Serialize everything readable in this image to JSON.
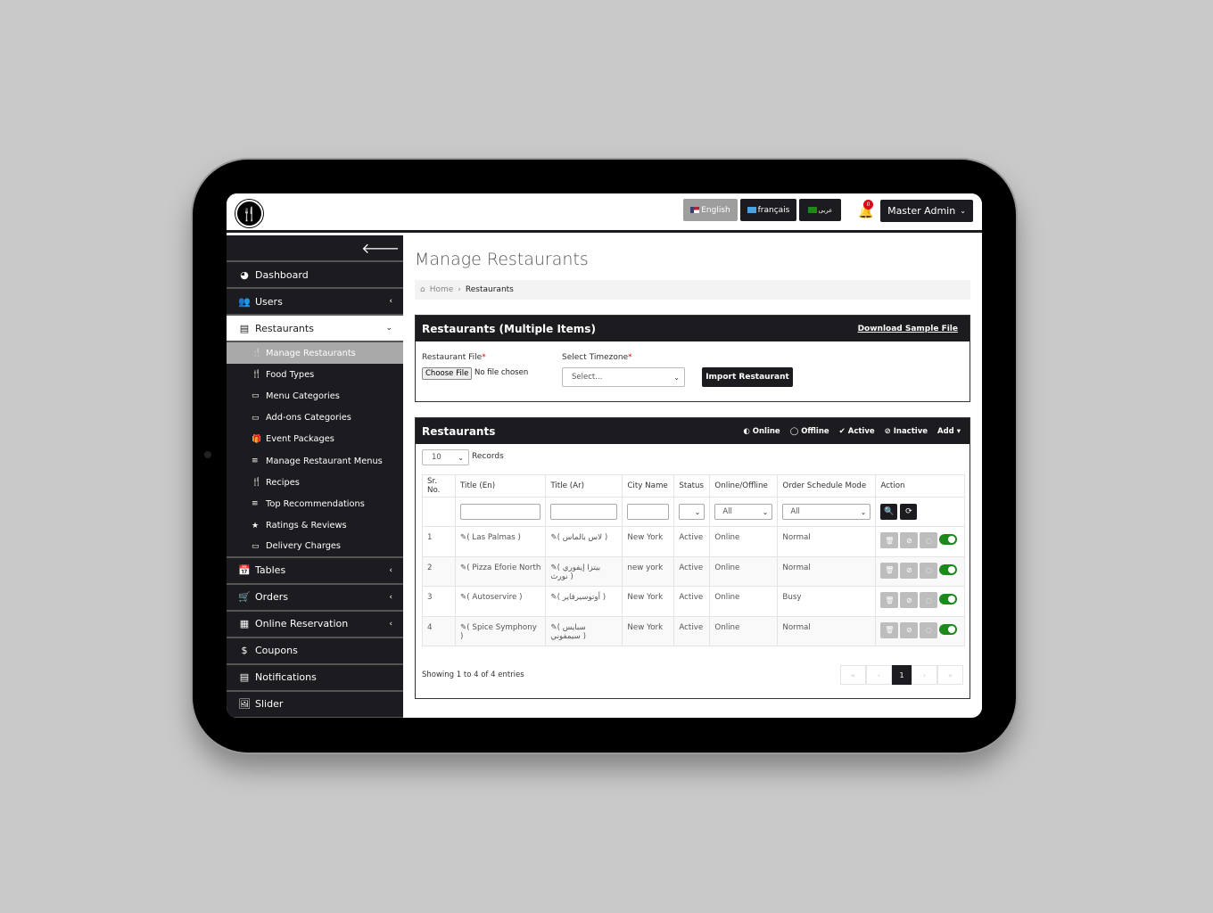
{
  "topbar": {
    "languages": [
      {
        "label": "English",
        "active": true
      },
      {
        "label": "français",
        "active": false
      },
      {
        "label": "عربى",
        "active": false
      }
    ],
    "notification_count": "0",
    "user_label": "Master Admin"
  },
  "sidebar": {
    "items": [
      {
        "label": "Dashboard",
        "icon": "dashboard-icon"
      },
      {
        "label": "Users",
        "icon": "users-icon"
      },
      {
        "label": "Restaurants",
        "icon": "file-icon"
      },
      {
        "label": "Tables",
        "icon": "calendar-icon"
      },
      {
        "label": "Orders",
        "icon": "cart-icon"
      },
      {
        "label": "Online Reservation",
        "icon": "calendar-grid-icon"
      },
      {
        "label": "Coupons",
        "icon": "dollar-icon"
      },
      {
        "label": "Notifications",
        "icon": "file-icon"
      },
      {
        "label": "Slider",
        "icon": "image-icon"
      }
    ],
    "sub_items": [
      {
        "label": "Manage Restaurants",
        "icon": "utensils-icon",
        "active": true
      },
      {
        "label": "Food Types",
        "icon": "utensils-icon"
      },
      {
        "label": "Menu Categories",
        "icon": "card-icon"
      },
      {
        "label": "Add-ons Categories",
        "icon": "card-icon"
      },
      {
        "label": "Event Packages",
        "icon": "gift-icon"
      },
      {
        "label": "Manage Restaurant Menus",
        "icon": "list-icon"
      },
      {
        "label": "Recipes",
        "icon": "utensils-icon"
      },
      {
        "label": "Top Recommendations",
        "icon": "list-icon"
      },
      {
        "label": "Ratings & Reviews",
        "icon": "star-icon"
      },
      {
        "label": "Delivery Charges",
        "icon": "card-icon"
      }
    ]
  },
  "page": {
    "title": "Manage Restaurants",
    "breadcrumb": {
      "home": "Home",
      "current": "Restaurants"
    }
  },
  "import_panel": {
    "title": "Restaurants (Multiple Items)",
    "download_link": "Download Sample File",
    "file_label": "Restaurant File",
    "file_button": "Choose File",
    "file_status": "No file chosen",
    "timezone_label": "Select Timezone",
    "timezone_placeholder": "Select...",
    "import_button": "Import Restaurant",
    "required_mark": "*"
  },
  "list_panel": {
    "title": "Restaurants",
    "header_actions": [
      "Online",
      "Offline",
      "Active",
      "Inactive",
      "Add"
    ],
    "records_value": "10",
    "records_label": "Records",
    "columns": [
      "Sr. No.",
      "Title (En)",
      "Title (Ar)",
      "City Name",
      "Status",
      "Online/Offline",
      "Order Schedule Mode",
      "Action"
    ],
    "filters": {
      "online_offline": "All",
      "schedule_mode": "All"
    },
    "rows": [
      {
        "sr": "1",
        "title_en": "( Las Palmas )",
        "title_ar": "( لاس بالماس )",
        "city": "New York",
        "status": "Active",
        "online": "Online",
        "mode": "Normal"
      },
      {
        "sr": "2",
        "title_en": "( Pizza Eforie North",
        "title_ar": "( بيتزا إيفوري نورث )",
        "city": "new york",
        "status": "Active",
        "online": "Online",
        "mode": "Normal"
      },
      {
        "sr": "3",
        "title_en": "( Autoservire )",
        "title_ar": "( أوتوسيرفاير )",
        "city": "New York",
        "status": "Active",
        "online": "Online",
        "mode": "Busy"
      },
      {
        "sr": "4",
        "title_en": "( Spice Symphony )",
        "title_ar": "( سبايس سيمفوني )",
        "city": "New York",
        "status": "Active",
        "online": "Online",
        "mode": "Normal"
      }
    ],
    "showing": "Showing 1 to 4 of 4 entries",
    "pagination": {
      "first": "«",
      "prev": "‹",
      "current": "1",
      "next": "›",
      "last": "»"
    }
  }
}
